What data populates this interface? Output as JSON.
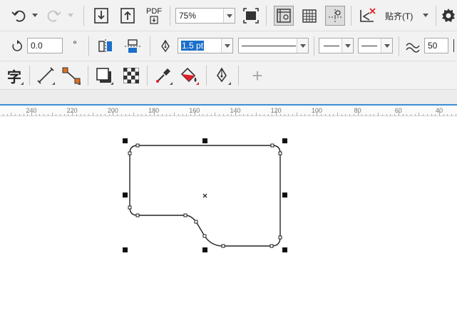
{
  "toolbar": {
    "export_label": "PDF",
    "zoom_value": "75%",
    "snap_label": "贴齐(T)",
    "snap_mnemonic": "T"
  },
  "property_bar": {
    "rotation_value": "0.0",
    "rotation_unit": "°",
    "outline_width_value": "1.5 pt",
    "smoothing_value": "50"
  },
  "toolbox": {
    "text_tool_glyph": "字",
    "add_tool_glyph": "+"
  },
  "ruler": {
    "ticks": [
      "240",
      "220",
      "200",
      "180",
      "160",
      "140",
      "120",
      "100",
      "80",
      "60",
      "40"
    ]
  },
  "colors": {
    "accent": "#1a6fc9",
    "ruler_line": "#3a8fd8",
    "toolbar_bg": "#f2f2f2",
    "fill_orange": "#e07020",
    "alert_red": "#e0202a"
  }
}
